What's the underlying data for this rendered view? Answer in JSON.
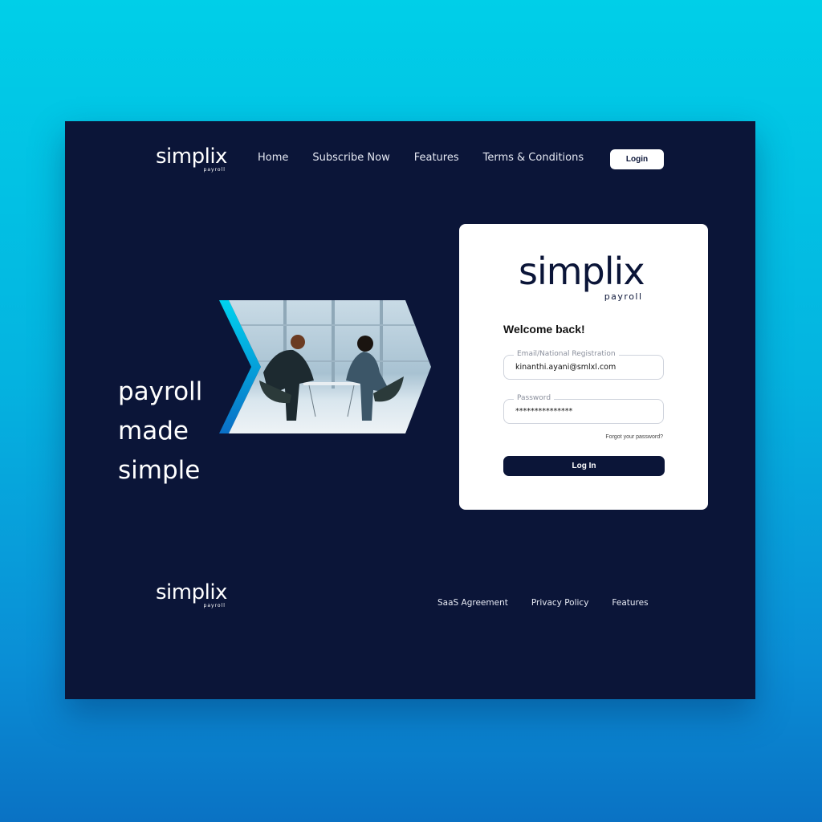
{
  "brand": {
    "name": "simplix",
    "sub": "payroll"
  },
  "nav": {
    "items": [
      "Home",
      "Subscribe Now",
      "Features",
      "Terms & Conditions"
    ],
    "login_label": "Login"
  },
  "hero": {
    "tagline_lines": [
      "payroll",
      "made",
      "simple"
    ],
    "image_alt": "Two people working on laptops at a table"
  },
  "login_card": {
    "welcome": "Welcome back!",
    "email": {
      "label": "Email/National Registration",
      "value": "kinanthi.ayani@smlxl.com"
    },
    "password": {
      "label": "Password",
      "value": "***************"
    },
    "forgot_label": "Forgot your password?",
    "submit_label": "Log In"
  },
  "footer": {
    "links": [
      "SaaS Agreement",
      "Privacy Policy",
      "Features"
    ]
  },
  "colors": {
    "navy": "#0b1538",
    "accent_cyan": "#00cfe8",
    "accent_blue": "#0a72c4"
  }
}
